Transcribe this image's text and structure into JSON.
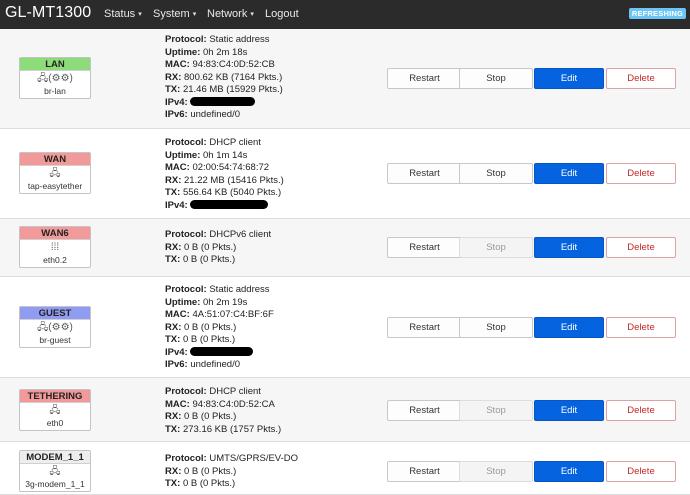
{
  "header": {
    "brand": "GL-MT1300",
    "nav": [
      {
        "label": "Status",
        "caret": "▾"
      },
      {
        "label": "System",
        "caret": "▾"
      },
      {
        "label": "Network",
        "caret": "▾"
      },
      {
        "label": "Logout",
        "caret": ""
      }
    ],
    "badge": "REFRESHING"
  },
  "buttons": {
    "restart": "Restart",
    "stop": "Stop",
    "edit": "Edit",
    "delete": "Delete"
  },
  "interfaces": [
    {
      "name": "LAN",
      "color": "#8ddc7a",
      "icons": "🖧(⚙⚙)",
      "device": "br-lan",
      "lines": [
        {
          "k": "Protocol:",
          "v": " Static address"
        },
        {
          "k": "Uptime:",
          "v": " 0h 2m 18s"
        },
        {
          "k": "MAC:",
          "v": " 94:83:C4:0D:52:CB"
        },
        {
          "k": "RX:",
          "v": " 800.62 KB (7164 Pkts.)"
        },
        {
          "k": "TX:",
          "v": " 21.46 MB (15929 Pkts.)"
        },
        {
          "k": "IPv4:",
          "v": "",
          "redacted": true
        },
        {
          "k": "IPv6:",
          "v": " undefined/0"
        }
      ]
    },
    {
      "name": "WAN",
      "color": "#f29a9a",
      "icons": "🖧",
      "device": "tap-easytether",
      "lines": [
        {
          "k": "Protocol:",
          "v": " DHCP client"
        },
        {
          "k": "Uptime:",
          "v": " 0h 1m 14s"
        },
        {
          "k": "MAC:",
          "v": " 02:00:54:74:68:72"
        },
        {
          "k": "RX:",
          "v": " 21.22 MB (15416 Pkts.)"
        },
        {
          "k": "TX:",
          "v": " 556.64 KB (5040 Pkts.)"
        },
        {
          "k": "IPv4:",
          "v": "",
          "redacted": true
        }
      ]
    },
    {
      "name": "WAN6",
      "color": "#f29a9a",
      "icons": "⁞⁞⁞",
      "device": "eth0.2",
      "lines": [
        {
          "k": "Protocol:",
          "v": " DHCPv6 client"
        },
        {
          "k": "RX:",
          "v": " 0 B (0 Pkts.)"
        },
        {
          "k": "TX:",
          "v": " 0 B (0 Pkts.)"
        }
      ]
    },
    {
      "name": "GUEST",
      "color": "#8f9cf2",
      "icons": "🖧(⚙⚙)",
      "device": "br-guest",
      "lines": [
        {
          "k": "Protocol:",
          "v": " Static address"
        },
        {
          "k": "Uptime:",
          "v": " 0h 2m 19s"
        },
        {
          "k": "MAC:",
          "v": " 4A:51:07:C4:BF:6F"
        },
        {
          "k": "RX:",
          "v": " 0 B (0 Pkts.)"
        },
        {
          "k": "TX:",
          "v": " 0 B (0 Pkts.)"
        },
        {
          "k": "IPv4:",
          "v": "",
          "redacted": true
        },
        {
          "k": "IPv6:",
          "v": " undefined/0"
        }
      ]
    },
    {
      "name": "TETHERING",
      "color": "#f29a9a",
      "icons": "🖧",
      "device": "eth0",
      "lines": [
        {
          "k": "Protocol:",
          "v": " DHCP client"
        },
        {
          "k": "MAC:",
          "v": " 94:83:C4:0D:52:CA"
        },
        {
          "k": "RX:",
          "v": " 0 B (0 Pkts.)"
        },
        {
          "k": "TX:",
          "v": " 273.16 KB (1757 Pkts.)"
        }
      ]
    },
    {
      "name": "MODEM_1_1",
      "color": "#eeeeee",
      "icons": "🖧",
      "device": "3g-modem_1_1",
      "lines": [
        {
          "k": "Protocol:",
          "v": " UMTS/GPRS/EV-DO"
        },
        {
          "k": "RX:",
          "v": " 0 B (0 Pkts.)"
        },
        {
          "k": "TX:",
          "v": " 0 B (0 Pkts.)"
        }
      ]
    }
  ]
}
